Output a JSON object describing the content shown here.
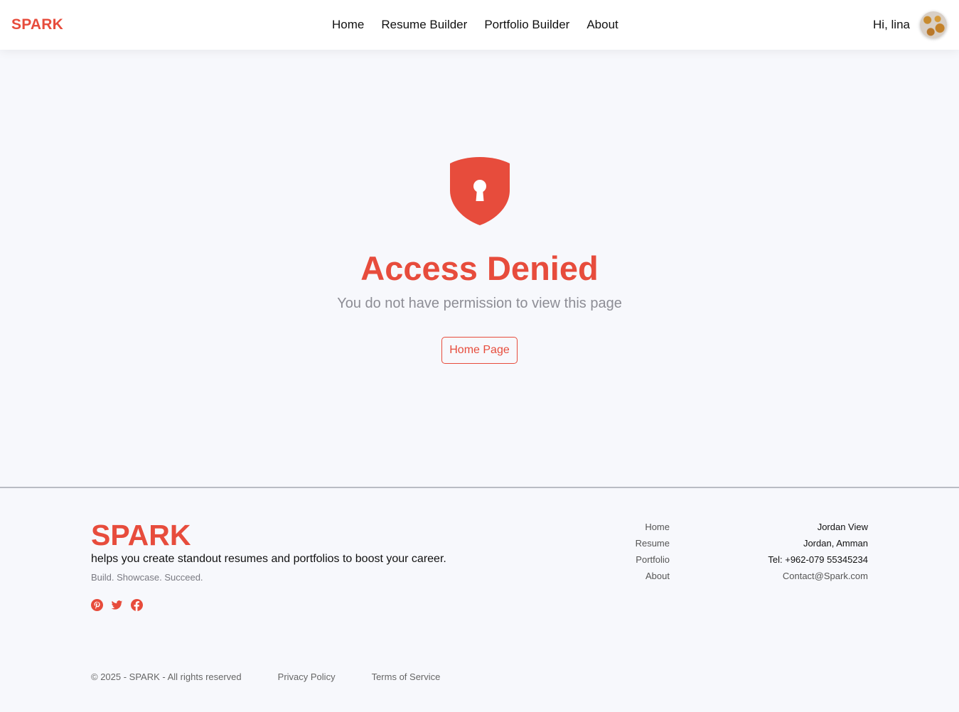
{
  "header": {
    "brand": "SPARK",
    "nav": [
      "Home",
      "Resume Builder",
      "Portfolio Builder",
      "About"
    ],
    "greeting": "Hi, lina",
    "avatar_icon": "user-avatar"
  },
  "main": {
    "icon": "shield-lock-icon",
    "title": "Access Denied",
    "subtitle": "You do not have permission to view this page",
    "button_label": "Home Page"
  },
  "footer": {
    "brand": "SPARK",
    "tagline": "helps you create standout resumes and portfolios to boost your career.",
    "motto": "Build. Showcase. Succeed.",
    "socials": [
      "pinterest-icon",
      "twitter-icon",
      "facebook-icon"
    ],
    "links": [
      "Home",
      "Resume",
      "Portfolio",
      "About"
    ],
    "contact": {
      "line1": "Jordan View",
      "line2": "Jordan, Amman",
      "tel": "Tel: +962-079 55345234",
      "email": "Contact@Spark.com"
    },
    "copyright": "© 2025 - SPARK - All rights reserved",
    "privacy": "Privacy Policy",
    "terms": "Terms of Service"
  },
  "colors": {
    "accent": "#e74c3c",
    "background": "#f7f8fc"
  }
}
